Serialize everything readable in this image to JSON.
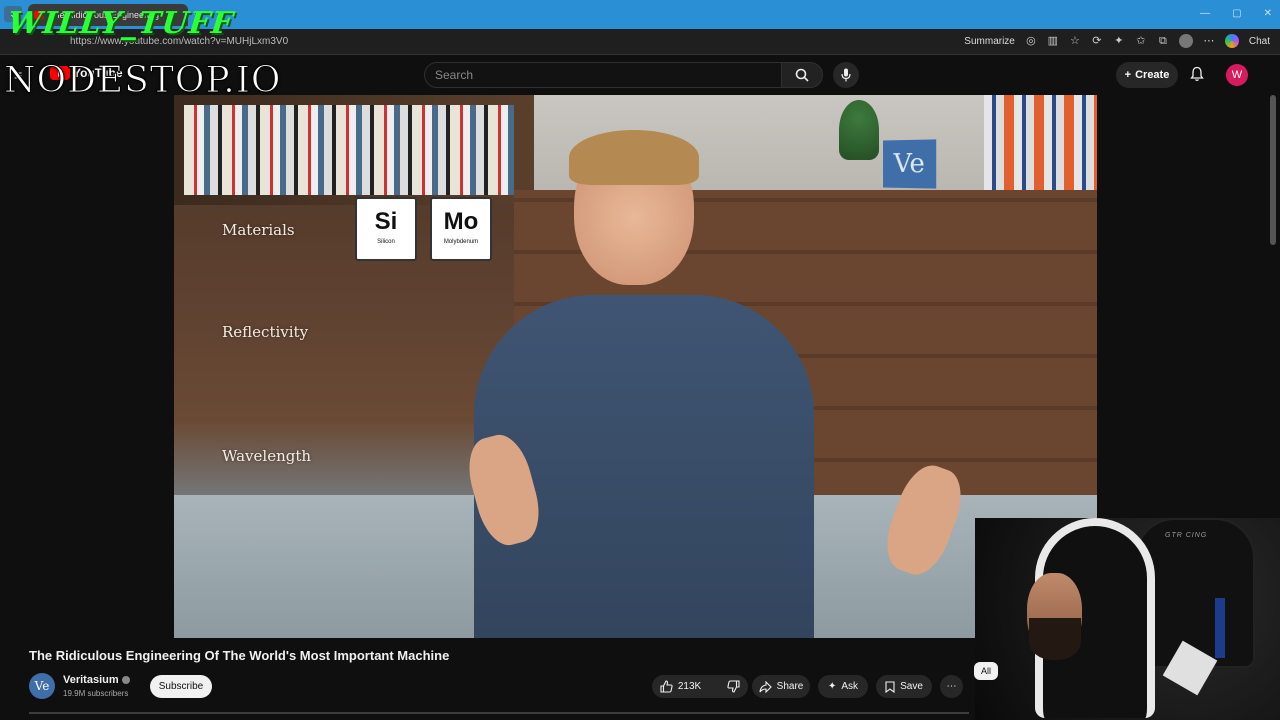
{
  "browser": {
    "tab_title": "The Ridiculous Engineering",
    "url": "https://www.youtube.com/watch?v=MUHjLxm3V0",
    "summarize_label": "Summarize",
    "chat_label": "Chat"
  },
  "overlay": {
    "streamer_name": "WILLY_TUFF",
    "site": "NODESTOP.IO"
  },
  "youtube": {
    "logo_text": "YouTube",
    "search_placeholder": "Search",
    "create_label": "Create",
    "user_initial": "W"
  },
  "video_overlay": {
    "labels": [
      "Materials",
      "Reflectivity",
      "Wavelength"
    ],
    "elements": [
      {
        "symbol": "Si",
        "name": "Silicon"
      },
      {
        "symbol": "Mo",
        "name": "Molybdenum"
      }
    ],
    "logo": "Ve"
  },
  "webcam": {
    "chair_text": "GTR CING"
  },
  "video_info": {
    "title": "The Ridiculous Engineering Of The World's Most Important Machine",
    "channel_initial": "Ve",
    "channel_name": "Veritasium",
    "subscribers": "19.9M subscribers",
    "subscribe_label": "Subscribe",
    "likes": "213K",
    "share_label": "Share",
    "ask_label": "Ask",
    "save_label": "Save",
    "chip_all": "All"
  },
  "colors": {
    "accent_red": "#ff0000",
    "overlay_green": "#2bff35",
    "tabbar_blue": "#2b8fd6",
    "avatar_pink": "#d81b60"
  }
}
